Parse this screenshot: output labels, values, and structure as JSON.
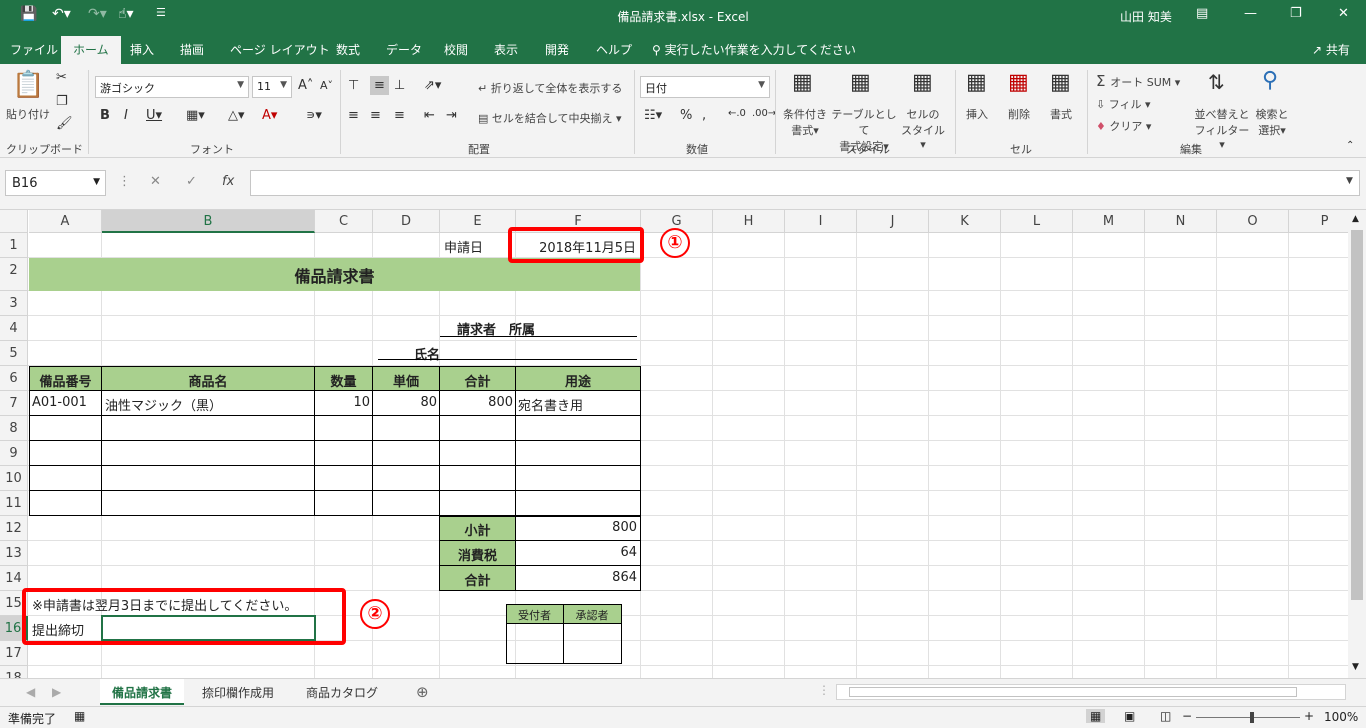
{
  "titlebar": {
    "doc_title": "備品請求書.xlsx  -  Excel",
    "user": "山田 知美"
  },
  "menu": {
    "tabs": [
      "ファイル",
      "ホーム",
      "挿入",
      "描画",
      "ページ レイアウト",
      "数式",
      "データ",
      "校閲",
      "表示",
      "開発",
      "ヘルプ"
    ],
    "tellme": "実行したい作業を入力してください",
    "share": "共有"
  },
  "ribbon": {
    "paste": "貼り付け",
    "font_name": "游ゴシック",
    "font_size": "11",
    "wrap": "折り返して全体を表示する",
    "merge": "セルを結合して中央揃え",
    "number_format": "日付",
    "cond_format": [
      "条件付き",
      "書式"
    ],
    "table_format": [
      "テーブルとして",
      "書式設定"
    ],
    "cell_style": [
      "セルの",
      "スタイル"
    ],
    "insert": "挿入",
    "delete": "削除",
    "format": "書式",
    "autosum": "オート SUM",
    "fill": "フィル",
    "clear": "クリア",
    "sort": [
      "並べ替えと",
      "フィルター"
    ],
    "find": [
      "検索と",
      "選択"
    ],
    "groups": {
      "clipboard": "クリップボード",
      "font": "フォント",
      "alignment": "配置",
      "number": "数値",
      "styles": "スタイル",
      "cells": "セル",
      "editing": "編集"
    }
  },
  "formula": {
    "namebox": "B16",
    "value": ""
  },
  "columns": [
    "A",
    "B",
    "C",
    "D",
    "E",
    "F",
    "G",
    "H",
    "I",
    "J",
    "K",
    "L",
    "M",
    "N",
    "O",
    "P"
  ],
  "rows": [
    "1",
    "2",
    "3",
    "4",
    "5",
    "6",
    "7",
    "8",
    "9",
    "10",
    "11",
    "12",
    "13",
    "14",
    "15",
    "16",
    "17",
    "18"
  ],
  "sheet": {
    "apply_date_label": "申請日",
    "apply_date": "2018年11月5日",
    "title": "備品請求書",
    "requester_dept": "請求者　所属",
    "requester_name": "氏名",
    "headers": [
      "備品番号",
      "商品名",
      "数量",
      "単価",
      "合計",
      "用途"
    ],
    "item": {
      "code": "A01-001",
      "name": "油性マジック（黒）",
      "qty": "10",
      "price": "80",
      "total": "800",
      "use": "宛名書き用"
    },
    "subtotal_label": "小計",
    "subtotal": "800",
    "tax_label": "消費税",
    "tax": "64",
    "total_label": "合計",
    "total": "864",
    "note": "※申請書は翌月3日までに提出してください。",
    "deadline_label": "提出締切",
    "stamp": [
      "受付者",
      "承認者"
    ]
  },
  "annotations": [
    "①",
    "②"
  ],
  "sheets": {
    "tabs": [
      "備品請求書",
      "捺印欄作成用",
      "商品カタログ"
    ]
  },
  "status": {
    "ready": "準備完了",
    "zoom": "100%"
  }
}
